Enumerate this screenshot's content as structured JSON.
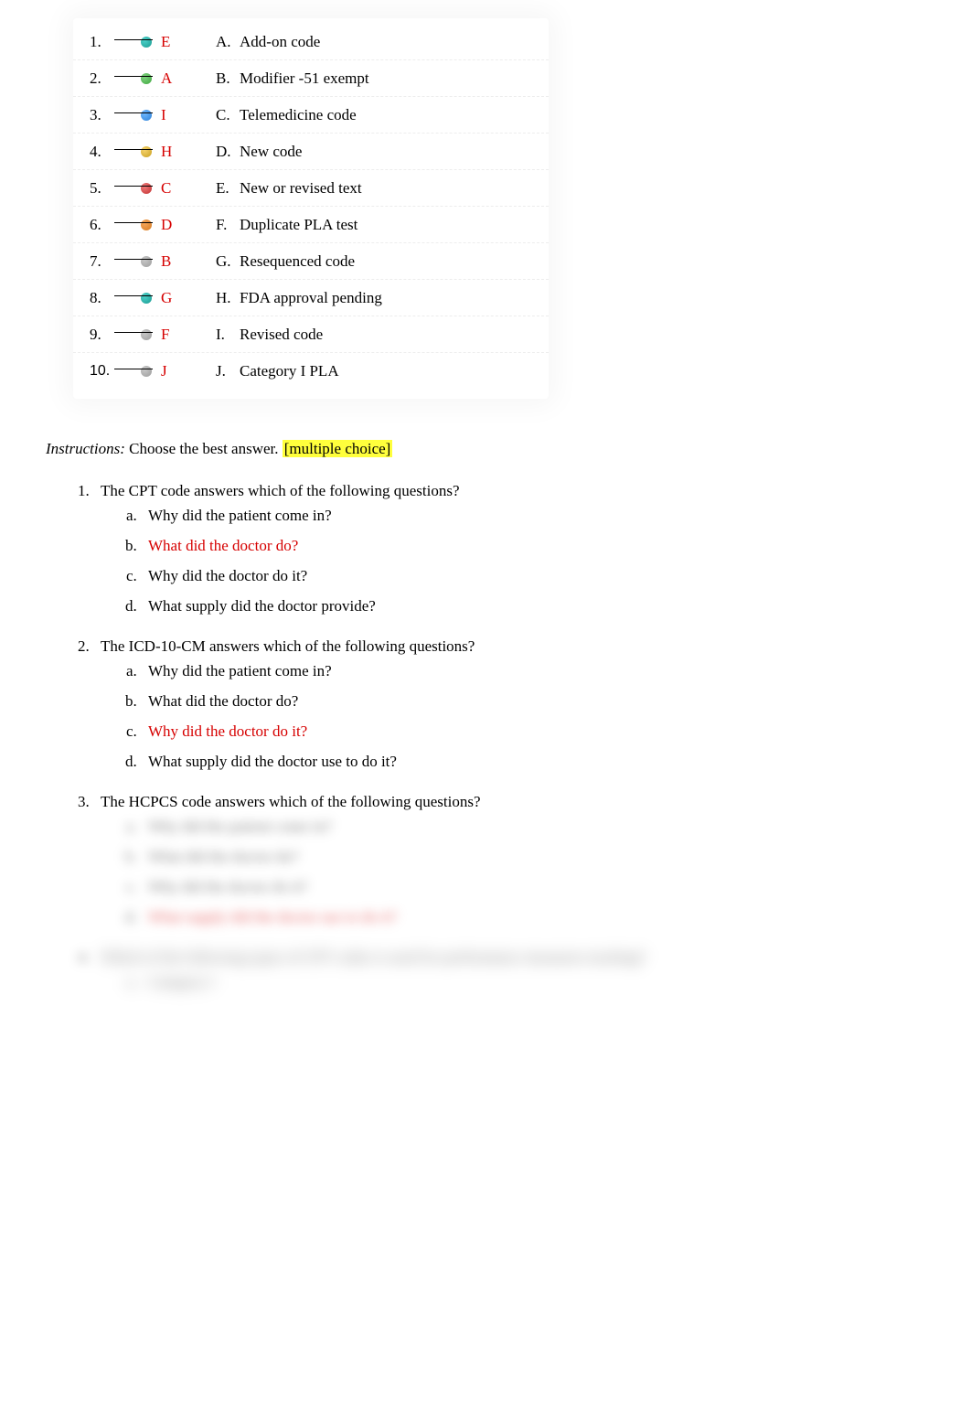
{
  "matching": {
    "left": [
      {
        "num": "1.",
        "answer": "E",
        "numClass": ""
      },
      {
        "num": "2.",
        "answer": "A",
        "numClass": ""
      },
      {
        "num": "3.",
        "answer": "I",
        "numClass": ""
      },
      {
        "num": "4.",
        "answer": "H",
        "numClass": ""
      },
      {
        "num": "5.",
        "answer": "C",
        "numClass": ""
      },
      {
        "num": "6.",
        "answer": "D",
        "numClass": ""
      },
      {
        "num": "7.",
        "answer": "B",
        "numClass": ""
      },
      {
        "num": "8.",
        "answer": "G",
        "numClass": ""
      },
      {
        "num": "9.",
        "answer": "F",
        "numClass": ""
      },
      {
        "num": "10.",
        "answer": "J",
        "numClass": "arial"
      }
    ],
    "right": [
      {
        "letter": "A.",
        "text": "Add-on code"
      },
      {
        "letter": "B.",
        "text": "Modifier -51 exempt"
      },
      {
        "letter": "C.",
        "text": "Telemedicine code"
      },
      {
        "letter": "D.",
        "text": "New code"
      },
      {
        "letter": "E.",
        "text": "New or revised text"
      },
      {
        "letter": "F.",
        "text": "Duplicate PLA test"
      },
      {
        "letter": "G.",
        "text": "Resequenced code"
      },
      {
        "letter": "H.",
        "text": "FDA approval pending"
      },
      {
        "letter": "I.",
        "text": "Revised code",
        "tightLetter": "I."
      },
      {
        "letter": "J.",
        "text": "Category I PLA"
      }
    ],
    "dotColors": [
      "dot-teal",
      "dot-green",
      "dot-blue",
      "dot-gold",
      "dot-red",
      "dot-orange",
      "dot-grey",
      "dot-teal",
      "dot-grey",
      "dot-grey"
    ]
  },
  "instructions": {
    "prefix": "Instructions:",
    "body": " Choose the best answer.",
    "tag": "[multiple choice]"
  },
  "mc": [
    {
      "q": "The CPT code answers which of the following questions?",
      "opts": [
        {
          "t": "Why did the patient come in?",
          "correct": false
        },
        {
          "t": "What did the doctor do?",
          "correct": true
        },
        {
          "t": "Why did the doctor do it?",
          "correct": false
        },
        {
          "t": "What supply did the doctor provide?",
          "correct": false
        }
      ],
      "blurred": false
    },
    {
      "q": "The ICD-10-CM answers which of the following questions?",
      "opts": [
        {
          "t": "Why did the patient come in?",
          "correct": false
        },
        {
          "t": "What did the doctor do?",
          "correct": false
        },
        {
          "t": "Why did the doctor do it?",
          "correct": true
        },
        {
          "t": "What supply did the doctor use to do it?",
          "correct": false
        }
      ],
      "blurred": false
    },
    {
      "q": "The HCPCS code answers which of the following questions?",
      "opts": [
        {
          "t": "Why did the patient come in?",
          "correct": false
        },
        {
          "t": "What did the doctor do?",
          "correct": false
        },
        {
          "t": "Why did the doctor do it?",
          "correct": false
        },
        {
          "t": "What supply did the doctor use to do it?",
          "correct": true
        }
      ],
      "blurred": true
    },
    {
      "q": "Which of the following types of CPT codes is used for performance measures tracking?",
      "opts": [
        {
          "t": "Category I",
          "correct": false
        }
      ],
      "blurred": true,
      "qBlurred": true
    }
  ]
}
